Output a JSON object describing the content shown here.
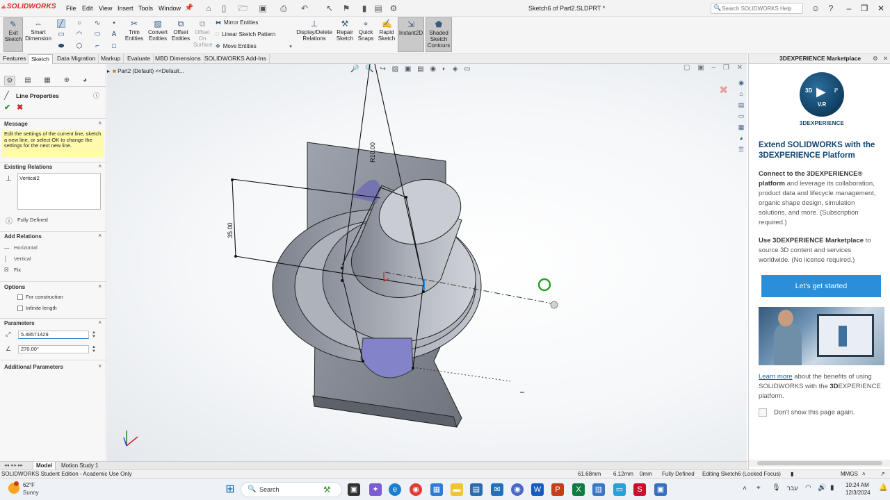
{
  "app": {
    "logo": "SOLIDWORKS",
    "doc_title": "Sketch6 of Part2.SLDPRT *"
  },
  "menu": [
    "File",
    "Edit",
    "View",
    "Insert",
    "Tools",
    "Window"
  ],
  "search": {
    "placeholder": "Search SOLIDWORKS Help"
  },
  "cmd": {
    "exit_sketch": "Exit Sketch",
    "smart_dimension": "Smart Dimension",
    "trim_entities": "Trim Entities",
    "convert_entities": "Convert Entities",
    "offset_entities": "Offset Entities",
    "offset_on_surface": "Offset On Surface",
    "mirror_entities": "Mirror Entities",
    "linear_sketch_pattern": "Linear Sketch Pattern",
    "move_entities": "Move Entities",
    "display_delete_relations": "Display/Delete Relations",
    "repair_sketch": "Repair Sketch",
    "quick_snaps": "Quick Snaps",
    "rapid_sketch": "Rapid Sketch",
    "instant2d": "Instant2D",
    "shaded_sketch_contours": "Shaded Sketch Contours"
  },
  "tabs": [
    "Features",
    "Sketch",
    "Data Migration",
    "Markup",
    "Evaluate",
    "MBD Dimensions",
    "SOLIDWORKS Add-Ins"
  ],
  "active_tab": "Sketch",
  "property_manager": {
    "title": "Line Properties",
    "message_header": "Message",
    "message": "Edit the settings of the current line, sketch a new line, or select OK to change the settings for the next new line.",
    "existing_relations_header": "Existing Relations",
    "existing_relations": [
      "Vertical2"
    ],
    "status": "Fully Defined",
    "add_relations_header": "Add Relations",
    "add_relations": [
      "Horizontal",
      "Vertical",
      "Fix"
    ],
    "options_header": "Options",
    "options": [
      "For construction",
      "Infinite length"
    ],
    "parameters_header": "Parameters",
    "length_value": "5.48571429",
    "angle_value": "270.00°",
    "additional_header": "Additional Parameters"
  },
  "tree": {
    "label": "Part2 (Default) <<Default..."
  },
  "dimensions": {
    "radius": "R10.00",
    "height": "35.00"
  },
  "bottom_tabs": [
    "Model",
    "Motion Study 1"
  ],
  "status_bar": {
    "edition": "SOLIDWORKS Student Edition - Academic Use Only",
    "x": "61.68mm",
    "y": "6.12mm",
    "z": "0mm",
    "state": "Fully Defined",
    "editing": "Editing Sketch6 (Locked Focus)",
    "units": "MMGS"
  },
  "task_pane": {
    "header": "3DEXPERIENCE Marketplace",
    "logo_word": "3DEXPERIENCE",
    "logo_3d": "3D",
    "logo_vr": "V.R",
    "logo_i": "i²",
    "title": "Extend SOLIDWORKS with the 3DEXPERIENCE Platform",
    "para1_bold": "Connect to the 3DEXPERIENCE® platform",
    "para1_rest": " and leverage its collaboration, product data and lifecycle management, organic shape design, simulation solutions, and more. (Subscription required.)",
    "para2_bold": "Use 3DEXPERIENCE Marketplace",
    "para2_rest": " to source 3D content and services worldwide. (No license required.)",
    "cta": "Let's get started",
    "learn_link": "Learn more",
    "learn_rest": " about the benefits of using SOLIDWORKS with the ",
    "learn_bold": "3D",
    "learn_tail": "EXPERIENCE platform.",
    "dont_show": "Don't show this page again."
  },
  "taskbar": {
    "weather_temp": "62°F",
    "weather_desc": "Sunny",
    "search": "Search",
    "lang": "עבר",
    "time": "10:24 AM",
    "date": "12/3/2024"
  }
}
